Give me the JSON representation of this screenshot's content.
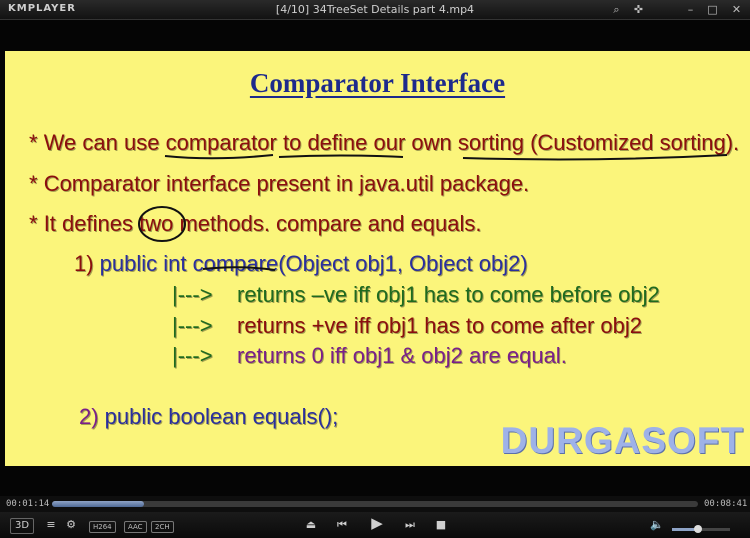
{
  "app": {
    "logo": "KMPLAYER",
    "window_title": "[4/10] 34TreeSet Details part 4.mp4"
  },
  "window_controls": {
    "search": "⌕",
    "pin": "✜",
    "minimize": "–",
    "maximize": "□",
    "close": "✕"
  },
  "slide": {
    "title": "Comparator Interface",
    "bullet1": {
      "star": "*",
      "t1": "We can use ",
      "u1": "comparator",
      "t2": " ",
      "u2": "to define our",
      "t3": " own ",
      "u3": "sorting",
      "t4": " ",
      "u4": "(Customized sorting).",
      "colon": ""
    },
    "bullet2": {
      "star": "*",
      "text": "Comparator interface present in java.util package."
    },
    "bullet3": {
      "star": "*",
      "t1": "It defines ",
      "two": "two",
      "t2": " methods. compare and equals."
    },
    "method1": {
      "num": "1)",
      "t1": " public int ",
      "u1": "compare",
      "t2": "(Object obj1, Object obj2)"
    },
    "returns": [
      {
        "arrow": "|--->",
        "text": "returns –ve iff obj1 has to come before obj2"
      },
      {
        "arrow": "|--->",
        "text": "returns +ve iff obj1 has to come after obj2"
      },
      {
        "arrow": "|--->",
        "text": "returns 0 iff obj1 & obj2 are equal."
      }
    ],
    "method2": {
      "num": "2)",
      "text": " public boolean equals();"
    },
    "watermark": "DURGASOFT"
  },
  "playback": {
    "current_time": "00:01:14",
    "total_time": "00:08:41",
    "progress": 0.142
  },
  "controls": {
    "three_d": "3D",
    "badge_video": "H264",
    "badge_audio": "AAC",
    "badge_channels": "2CH",
    "volume": 0.45
  },
  "colors": {
    "slide_bg": "#fbf57b",
    "text_red": "#8b0e0e",
    "text_blue": "#2a2f9e",
    "text_green": "#1f6a1f",
    "text_purple": "#7a1f8a",
    "watermark": "#9eb2e8"
  }
}
